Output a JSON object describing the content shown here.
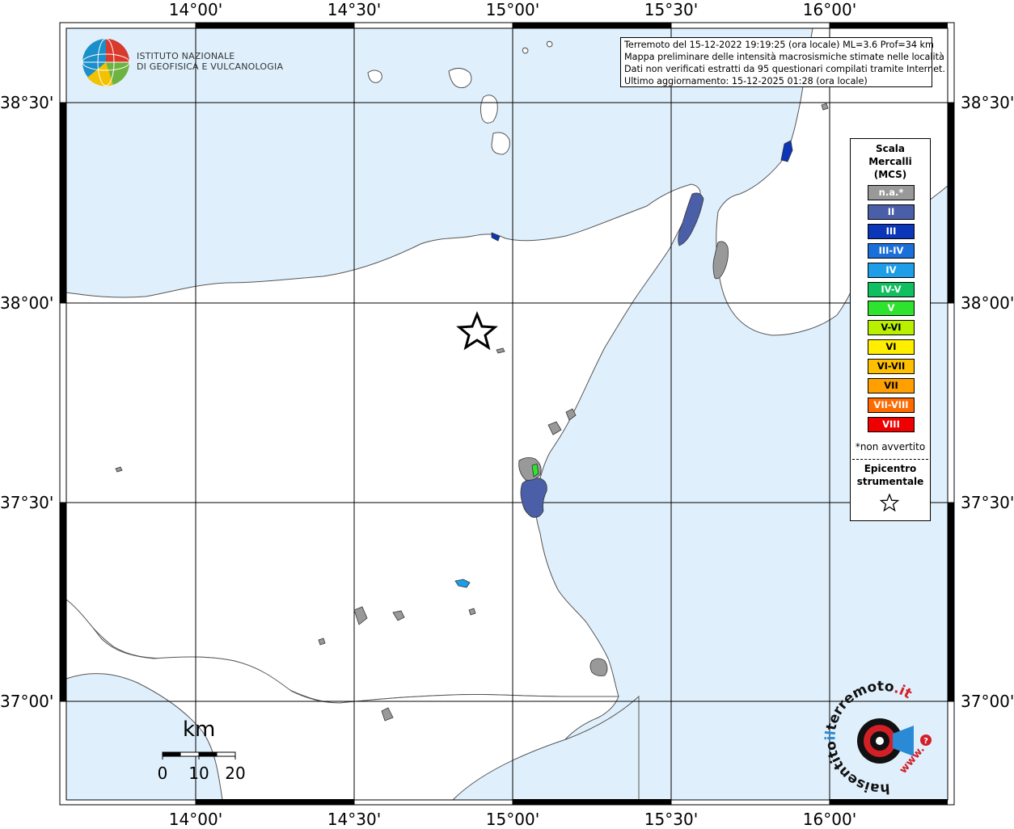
{
  "map": {
    "info": {
      "line1": "Terremoto del 15-12-2022 19:19:25 (ora locale) ML=3.6 Prof=34 km",
      "line2": "Mappa preliminare delle intensità macrosismiche stimate nelle località",
      "line3": "Dati non verificati estratti da 95 questionari compilati tramite Internet.",
      "line4": "Ultimo aggiornamento: 15-12-2025 01:28 (ora locale)"
    },
    "longitude_labels": [
      "14°00'",
      "14°30'",
      "15°00'",
      "15°30'",
      "16°00'"
    ],
    "latitude_labels": [
      "38°30'",
      "38°00'",
      "37°30'",
      "37°00'"
    ],
    "logo": {
      "line1": "ISTITUTO NAZIONALE",
      "line2": "DI GEOFISICA E VULCANOLOGIA"
    },
    "scale_bar": {
      "unit": "km",
      "ticks": [
        "0",
        "10",
        "20"
      ]
    },
    "legend": {
      "title_line1": "Scala",
      "title_line2": "Mercalli",
      "title_line3": "(MCS)",
      "classes": [
        {
          "label": "n.a.*",
          "color": "#999999"
        },
        {
          "label": "II",
          "color": "#4b5fa8"
        },
        {
          "label": "III",
          "color": "#0b36b8"
        },
        {
          "label": "III-IV",
          "color": "#1a6fd9"
        },
        {
          "label": "IV",
          "color": "#1e9ee8"
        },
        {
          "label": "IV-V",
          "color": "#10c060"
        },
        {
          "label": "V",
          "color": "#2ee32e"
        },
        {
          "label": "V-VI",
          "color": "#b8f000"
        },
        {
          "label": "VI",
          "color": "#ffee00"
        },
        {
          "label": "VI-VII",
          "color": "#ffc000"
        },
        {
          "label": "VII",
          "color": "#ff9f00"
        },
        {
          "label": "VII-VIII",
          "color": "#ff6a00"
        },
        {
          "label": "VIII",
          "color": "#ee0000"
        }
      ],
      "note": "*non avvertito",
      "epicenter_line1": "Epicentro",
      "epicenter_line2": "strumentale"
    },
    "watermark": {
      "text": "haisentitoilterremoto.it",
      "www": "www."
    },
    "colors": {
      "sea": "#dff0fc",
      "land": "#ffffff",
      "grid": "#000000"
    }
  }
}
